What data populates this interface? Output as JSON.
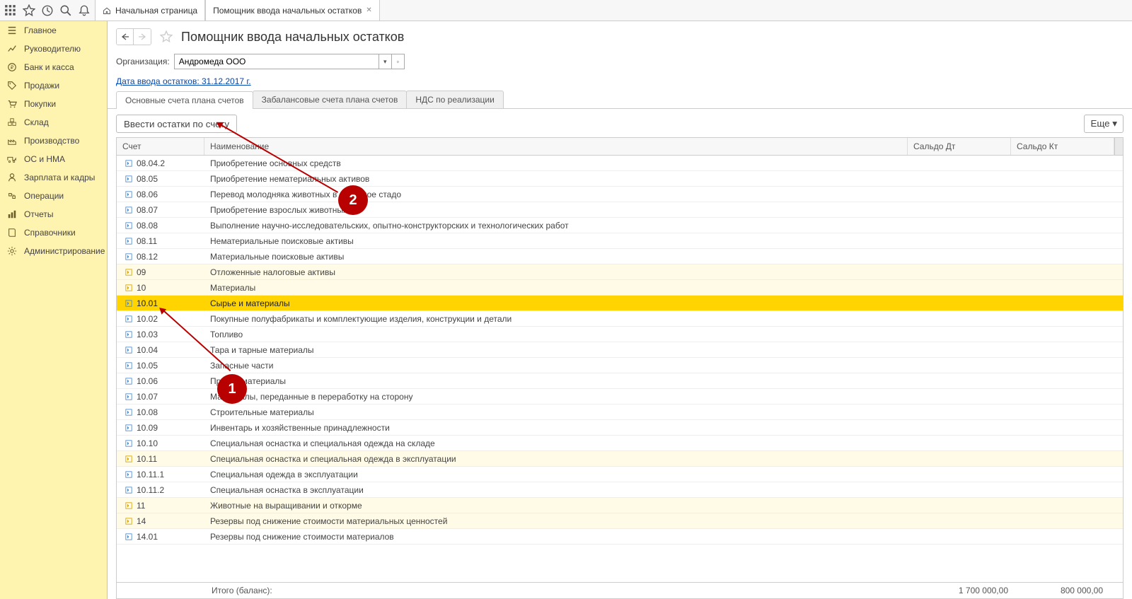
{
  "toolbar": {
    "home_tab": "Начальная страница",
    "assistant_tab": "Помощник ввода начальных остатков"
  },
  "sidebar": {
    "items": [
      {
        "label": "Главное",
        "icon": "menu"
      },
      {
        "label": "Руководителю",
        "icon": "chart"
      },
      {
        "label": "Банк и касса",
        "icon": "coin"
      },
      {
        "label": "Продажи",
        "icon": "tag"
      },
      {
        "label": "Покупки",
        "icon": "cart"
      },
      {
        "label": "Склад",
        "icon": "boxes"
      },
      {
        "label": "Производство",
        "icon": "factory"
      },
      {
        "label": "ОС и НМА",
        "icon": "truck"
      },
      {
        "label": "Зарплата и кадры",
        "icon": "person"
      },
      {
        "label": "Операции",
        "icon": "ops"
      },
      {
        "label": "Отчеты",
        "icon": "bars"
      },
      {
        "label": "Справочники",
        "icon": "book"
      },
      {
        "label": "Администрирование",
        "icon": "gear"
      }
    ]
  },
  "header": {
    "title": "Помощник ввода начальных остатков",
    "org_label": "Организация:",
    "org_value": "Андромеда ООО",
    "date_link": "Дата ввода остатков: 31.12.2017 г."
  },
  "tabs": [
    "Основные счета плана счетов",
    "Забалансовые счета плана счетов",
    "НДС по реализации"
  ],
  "actions": {
    "enter_button": "Ввести остатки по счету",
    "more_button": "Еще"
  },
  "table": {
    "headers": {
      "acct": "Счет",
      "name": "Наименование",
      "dt": "Сальдо Дт",
      "kt": "Сальдо Кт"
    },
    "rows": [
      {
        "acct": "08.04.2",
        "name": "Приобретение основных средств",
        "parent": false
      },
      {
        "acct": "08.05",
        "name": "Приобретение нематериальных активов",
        "parent": false
      },
      {
        "acct": "08.06",
        "name": "Перевод молодняка животных в основное стадо",
        "parent": false
      },
      {
        "acct": "08.07",
        "name": "Приобретение взрослых животных",
        "parent": false
      },
      {
        "acct": "08.08",
        "name": "Выполнение научно-исследовательских, опытно-конструкторских и технологических работ",
        "parent": false
      },
      {
        "acct": "08.11",
        "name": "Нематериальные поисковые активы",
        "parent": false
      },
      {
        "acct": "08.12",
        "name": "Материальные поисковые активы",
        "parent": false
      },
      {
        "acct": "09",
        "name": "Отложенные налоговые активы",
        "parent": true
      },
      {
        "acct": "10",
        "name": "Материалы",
        "parent": true
      },
      {
        "acct": "10.01",
        "name": "Сырье и материалы",
        "parent": false,
        "selected": true
      },
      {
        "acct": "10.02",
        "name": "Покупные полуфабрикаты и комплектующие изделия, конструкции и детали",
        "parent": false
      },
      {
        "acct": "10.03",
        "name": "Топливо",
        "parent": false
      },
      {
        "acct": "10.04",
        "name": "Тара и тарные материалы",
        "parent": false
      },
      {
        "acct": "10.05",
        "name": "Запасные части",
        "parent": false
      },
      {
        "acct": "10.06",
        "name": "Прочие материалы",
        "parent": false
      },
      {
        "acct": "10.07",
        "name": "Материалы, переданные в переработку на сторону",
        "parent": false
      },
      {
        "acct": "10.08",
        "name": "Строительные материалы",
        "parent": false
      },
      {
        "acct": "10.09",
        "name": "Инвентарь и хозяйственные принадлежности",
        "parent": false
      },
      {
        "acct": "10.10",
        "name": "Специальная оснастка и специальная одежда на складе",
        "parent": false
      },
      {
        "acct": "10.11",
        "name": "Специальная оснастка и специальная одежда в эксплуатации",
        "parent": true
      },
      {
        "acct": "10.11.1",
        "name": "Специальная одежда в эксплуатации",
        "parent": false
      },
      {
        "acct": "10.11.2",
        "name": "Специальная оснастка в эксплуатации",
        "parent": false
      },
      {
        "acct": "11",
        "name": "Животные на выращивании и откорме",
        "parent": true
      },
      {
        "acct": "14",
        "name": "Резервы под снижение стоимости материальных ценностей",
        "parent": true
      },
      {
        "acct": "14.01",
        "name": "Резервы под снижение стоимости материалов",
        "parent": false
      }
    ],
    "footer": {
      "label": "Итого (баланс):",
      "dt": "1 700 000,00",
      "kt": "800 000,00"
    }
  },
  "markers": {
    "m1": "1",
    "m2": "2"
  }
}
